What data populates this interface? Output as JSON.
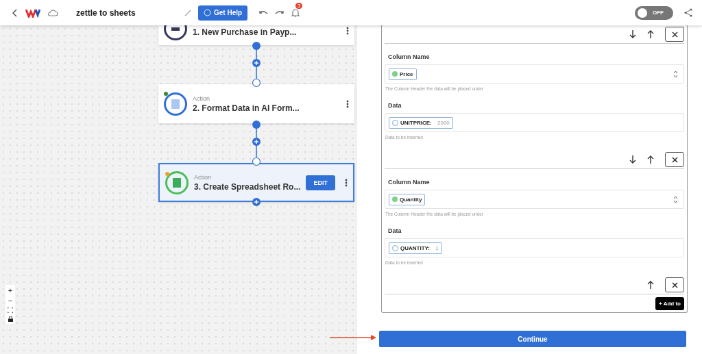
{
  "top_bar": {
    "title": "zettle to sheets",
    "help_button": "Get Help",
    "notification_count": "3",
    "toggle": {
      "on": false,
      "label": "OFF"
    }
  },
  "nodes": [
    {
      "title": "1. New Purchase in Payp...",
      "selected": false
    },
    {
      "type_label": "Action",
      "title": "2. Format Data in AI Form...",
      "selected": false,
      "color": "#3a8a3a"
    },
    {
      "type_label": "Action",
      "title": "3. Create Spreadsheet Ro...",
      "selected": true,
      "edit_button": "EDIT",
      "color": "#f0a030"
    }
  ],
  "zoom_controls": [
    "+",
    "−"
  ],
  "panel": {
    "previous_controls": {
      "can_move_down": true
    },
    "mappings": [
      {
        "column_label": "Column Name",
        "column_value": "Price",
        "column_hint": "The Column Header the data will be placed under",
        "data_label": "Data",
        "data_key": "UNITPRICE:",
        "data_value": "2000",
        "data_hint": "Data to be inserted",
        "can_move_down": true
      },
      {
        "column_label": "Column Name",
        "column_value": "Quantity",
        "column_hint": "The Column Header the data will be placed under",
        "data_label": "Data",
        "data_key": "QUANTITY:",
        "data_value": "1",
        "data_hint": "Data to be inserted",
        "can_move_down": false
      }
    ],
    "add_button": "+ Add to",
    "continue_button": "Continue"
  }
}
